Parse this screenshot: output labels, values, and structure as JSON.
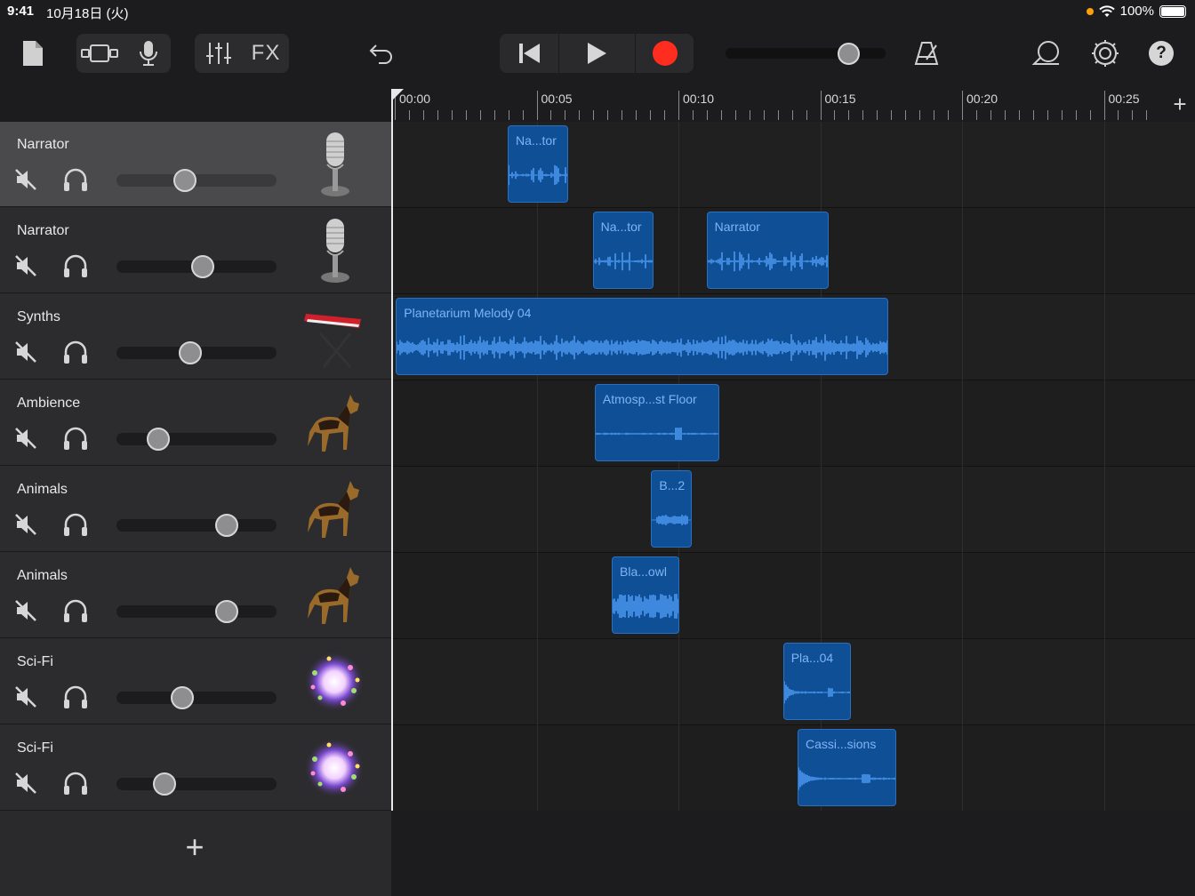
{
  "status": {
    "time": "9:41",
    "date": "10月18日 (火)",
    "battery": "100%"
  },
  "toolbar": {
    "fx_label": "FX",
    "icons": [
      "document-icon",
      "view-toggle-icon",
      "microphone-icon",
      "mixer-icon",
      "fx-button",
      "undo-icon",
      "rewind-icon",
      "play-icon",
      "record-icon",
      "master-volume-slider",
      "metronome-icon",
      "loop-icon",
      "settings-icon",
      "help-icon"
    ],
    "record_color": "#ff2d20",
    "master_volume": 0.76
  },
  "ruler": {
    "labels": [
      "00:00",
      "00:05",
      "00:10",
      "00:15",
      "00:20",
      "00:25"
    ]
  },
  "tracks": [
    {
      "name": "Narrator",
      "instrument": "microphone-icon",
      "volume": 0.43,
      "selected": true
    },
    {
      "name": "Narrator",
      "instrument": "microphone-icon",
      "volume": 0.54,
      "selected": false
    },
    {
      "name": "Synths",
      "instrument": "keyboard-icon",
      "volume": 0.46,
      "selected": false
    },
    {
      "name": "Ambience",
      "instrument": "dog-icon",
      "volume": 0.26,
      "selected": false
    },
    {
      "name": "Animals",
      "instrument": "dog-icon",
      "volume": 0.69,
      "selected": false
    },
    {
      "name": "Animals",
      "instrument": "dog-icon",
      "volume": 0.69,
      "selected": false
    },
    {
      "name": "Sci-Fi",
      "instrument": "sparkle-icon",
      "volume": 0.41,
      "selected": false
    },
    {
      "name": "Sci-Fi",
      "instrument": "sparkle-icon",
      "volume": 0.3,
      "selected": false
    }
  ],
  "regions": [
    {
      "track": 0,
      "name": "Na...tor",
      "start": 3.98,
      "end": 6.1,
      "wave": "speech"
    },
    {
      "track": 1,
      "name": "Na...tor",
      "start": 6.98,
      "end": 9.13,
      "wave": "speech"
    },
    {
      "track": 1,
      "name": "Narrator",
      "start": 10.99,
      "end": 15.3,
      "wave": "speech"
    },
    {
      "track": 2,
      "name": "Planetarium Melody 04",
      "start": 0.04,
      "end": 17.4,
      "wave": "dense"
    },
    {
      "track": 3,
      "name": "Atmosp...st Floor",
      "start": 7.05,
      "end": 11.44,
      "wave": "flat"
    },
    {
      "track": 4,
      "name": "B...2",
      "start": 9.04,
      "end": 10.47,
      "wave": "blip"
    },
    {
      "track": 5,
      "name": "Bla...owl",
      "start": 7.65,
      "end": 10.02,
      "wave": "loud"
    },
    {
      "track": 6,
      "name": "Pla...04",
      "start": 13.69,
      "end": 16.09,
      "wave": "decay"
    },
    {
      "track": 7,
      "name": "Cassi...sions",
      "start": 14.2,
      "end": 17.69,
      "wave": "decay"
    }
  ],
  "add_track_label": "+",
  "add_section_label": "+",
  "colors": {
    "region": "#0f4f96",
    "region_text": "#7fb4f5",
    "waveform": "#4a98f0",
    "record": "#ff2d20"
  }
}
